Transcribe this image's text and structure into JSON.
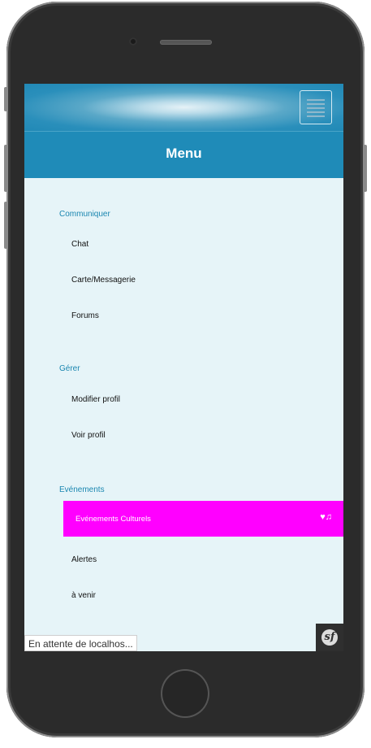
{
  "header": {
    "title": "Menu",
    "menu_icon": "hamburger-icon"
  },
  "sections": [
    {
      "label": "Communiquer",
      "items": [
        "Chat",
        "Carte/Messagerie",
        "Forums"
      ]
    },
    {
      "label": "Gérer",
      "items": [
        "Modifier profil",
        "Voir profil"
      ]
    },
    {
      "label": "Evénements",
      "items": [
        "Evénements Culturels",
        "Alertes",
        "à venir"
      ]
    }
  ],
  "active_item": {
    "label": "Evénements Culturels",
    "icons": "♥♫"
  },
  "status_bar": {
    "text": "En attente de localhos..."
  },
  "colors": {
    "accent": "#1f8bb8",
    "active": "#ff00ff",
    "background": "#e6f4f8"
  },
  "devtools_badge": {
    "glyph": "sf"
  }
}
